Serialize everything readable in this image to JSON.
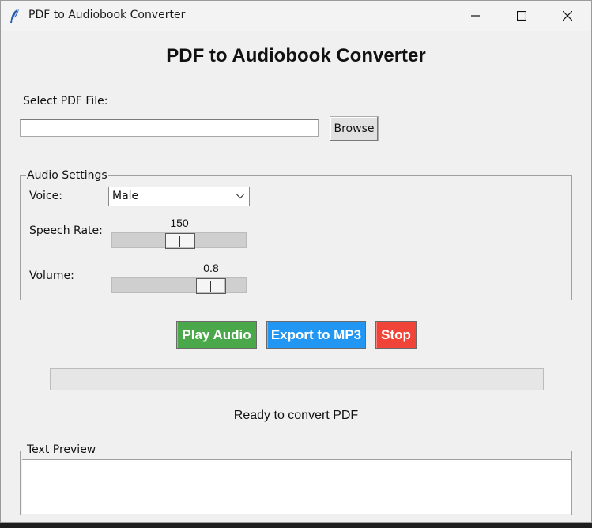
{
  "window": {
    "title": "PDF to Audiobook Converter",
    "controls": [
      "minimize-icon",
      "maximize-icon",
      "close-icon"
    ]
  },
  "heading": "PDF to Audiobook Converter",
  "file": {
    "label": "Select PDF File:",
    "value": "",
    "browse_label": "Browse"
  },
  "audio_settings": {
    "title": "Audio Settings",
    "voice_label": "Voice:",
    "voice_value": "Male",
    "rate_label": "Speech Rate:",
    "rate_value": "150",
    "volume_label": "Volume:",
    "volume_value": "0.8"
  },
  "actions": {
    "play_label": "Play Audio",
    "export_label": "Export to MP3",
    "stop_label": "Stop",
    "play_color": "#4aa84a",
    "export_color": "#2196f3",
    "stop_color": "#f04438"
  },
  "progress": {
    "value_percent": 0
  },
  "status_text": "Ready to convert PDF",
  "preview": {
    "title": "Text Preview",
    "content": ""
  }
}
